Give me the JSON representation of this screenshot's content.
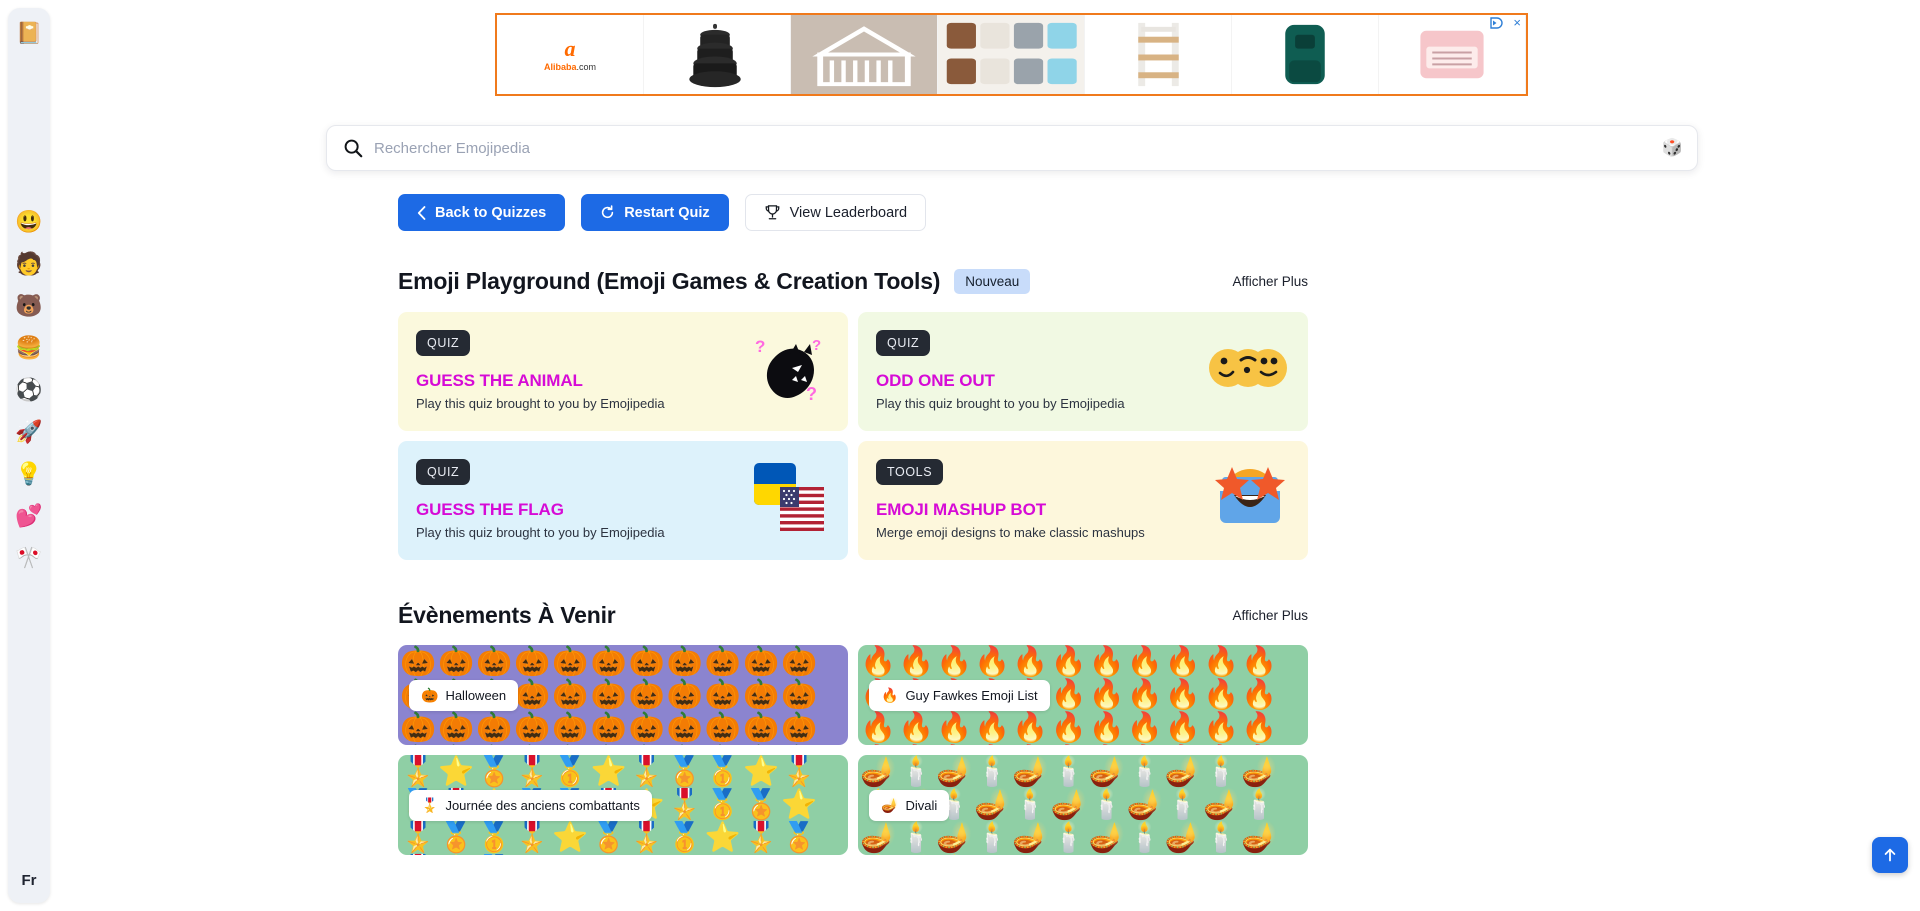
{
  "sidebar": {
    "logo_icon": "emoji-book-icon",
    "logo_glyph": "📔",
    "items": [
      {
        "name": "smileys",
        "glyph": "😃"
      },
      {
        "name": "people",
        "glyph": "🧑"
      },
      {
        "name": "animals",
        "glyph": "🐻"
      },
      {
        "name": "food",
        "glyph": "🍔"
      },
      {
        "name": "activity",
        "glyph": "⚽"
      },
      {
        "name": "travel",
        "glyph": "🚀"
      },
      {
        "name": "objects",
        "glyph": "💡"
      },
      {
        "name": "symbols",
        "glyph": "💕"
      },
      {
        "name": "flags",
        "glyph": "🎌"
      }
    ],
    "language": "Fr"
  },
  "ad": {
    "brand_mark": "ɑ",
    "brand_word": "Alibaba",
    "brand_word_suffix": ".com",
    "adchoices_label": "AdChoices",
    "close_label": "×"
  },
  "search": {
    "placeholder": "Rechercher Emojipedia",
    "value": "",
    "icon": "search-icon",
    "random_icon": "dice-icon",
    "random_glyph": "🎲"
  },
  "toolbar": {
    "back_label": "Back to Quizzes",
    "restart_label": "Restart Quiz",
    "leaderboard_label": "View Leaderboard"
  },
  "playground": {
    "title": "Emoji Playground (Emoji Games & Creation Tools)",
    "badge": "Nouveau",
    "show_more": "Afficher Plus",
    "cards": [
      {
        "tag": "QUIZ",
        "title": "GUESS THE ANIMAL",
        "subtitle": "Play this quiz brought to you by Emojipedia",
        "bg": "#fbf9dd",
        "art_glyph": "🐉",
        "art_name": "animal-silhouette-art"
      },
      {
        "tag": "QUIZ",
        "title": "ODD ONE OUT",
        "subtitle": "Play this quiz brought to you by Emojipedia",
        "bg": "#f1f9e3",
        "art_glyph": "😏",
        "art_name": "odd-one-out-art"
      },
      {
        "tag": "QUIZ",
        "title": "GUESS THE FLAG",
        "subtitle": "Play this quiz brought to you by Emojipedia",
        "bg": "#ddf2fb",
        "art_glyph": "🇺🇸",
        "art_name": "flags-art"
      },
      {
        "tag": "TOOLS",
        "title": "EMOJI MASHUP BOT",
        "subtitle": "Merge emoji designs to make classic mashups",
        "bg": "#fdf7dc",
        "art_glyph": "🤩",
        "art_name": "mashup-bot-art"
      }
    ]
  },
  "events": {
    "title": "Évènements À Venir",
    "show_more": "Afficher Plus",
    "items": [
      {
        "label": "Halloween",
        "emoji": "🎃",
        "bg": "#8b84cf",
        "pattern": "🎃🎃🎃🎃🎃🎃🎃🎃🎃🎃🎃🎃🎃🎃🎃🎃🎃🎃🎃🎃🎃🎃🎃🎃🎃🎃🎃🎃🎃🎃🎃🎃🎃🎃🎃🎃🎃🎃🎃🎃🎃🎃🎃🎃🎃🎃🎃🎃🎃🎃🎃🎃🎃🎃"
      },
      {
        "label": "Guy Fawkes Emoji List",
        "emoji": "🔥",
        "bg": "#8fcfa5",
        "pattern": "🔥🔥🔥🔥🔥🔥🔥🔥🔥🔥🔥🔥🔥🔥🔥🔥🔥🔥🔥🔥🔥🔥🔥🔥🔥🔥🔥🔥🔥🔥🔥🔥🔥🔥🔥🔥🔥🔥🔥🔥🔥🔥🔥🔥🔥🔥🔥🔥🔥🔥🔥🔥🔥🔥"
      },
      {
        "label": "Journée des anciens combattants",
        "emoji": "🎖️",
        "bg": "#8fcfa5",
        "pattern": "🎖️⭐🏅🎖️🥇⭐🎖️🏅🥇⭐🎖️🏅🎖️⭐🥇🏅🎖️⭐🎖️🥇🏅⭐🎖️🏅🥇🎖️⭐🏅🎖️🥇⭐🎖️🏅🎖️⭐🥇"
      },
      {
        "label": "Divali",
        "emoji": "🪔",
        "bg": "#8fcfa5",
        "pattern": "🪔🕯️🪔🕯️🪔🕯️🪔🕯️🪔🕯️🪔🕯️🪔🕯️🪔🕯️🪔🕯️🪔🕯️🪔🕯️🪔🕯️🪔🕯️🪔🕯️🪔🕯️🪔🕯️🪔🕯️🪔🕯️"
      }
    ]
  },
  "scroll_top": {
    "icon": "arrow-up-icon",
    "glyph": "↑"
  },
  "colors": {
    "accent": "#1d6ae5",
    "card_title": "#d60bd6",
    "badge_new_bg": "#c8dcfa",
    "tag_bg": "#252a33",
    "ad_border": "#f07a1c"
  }
}
